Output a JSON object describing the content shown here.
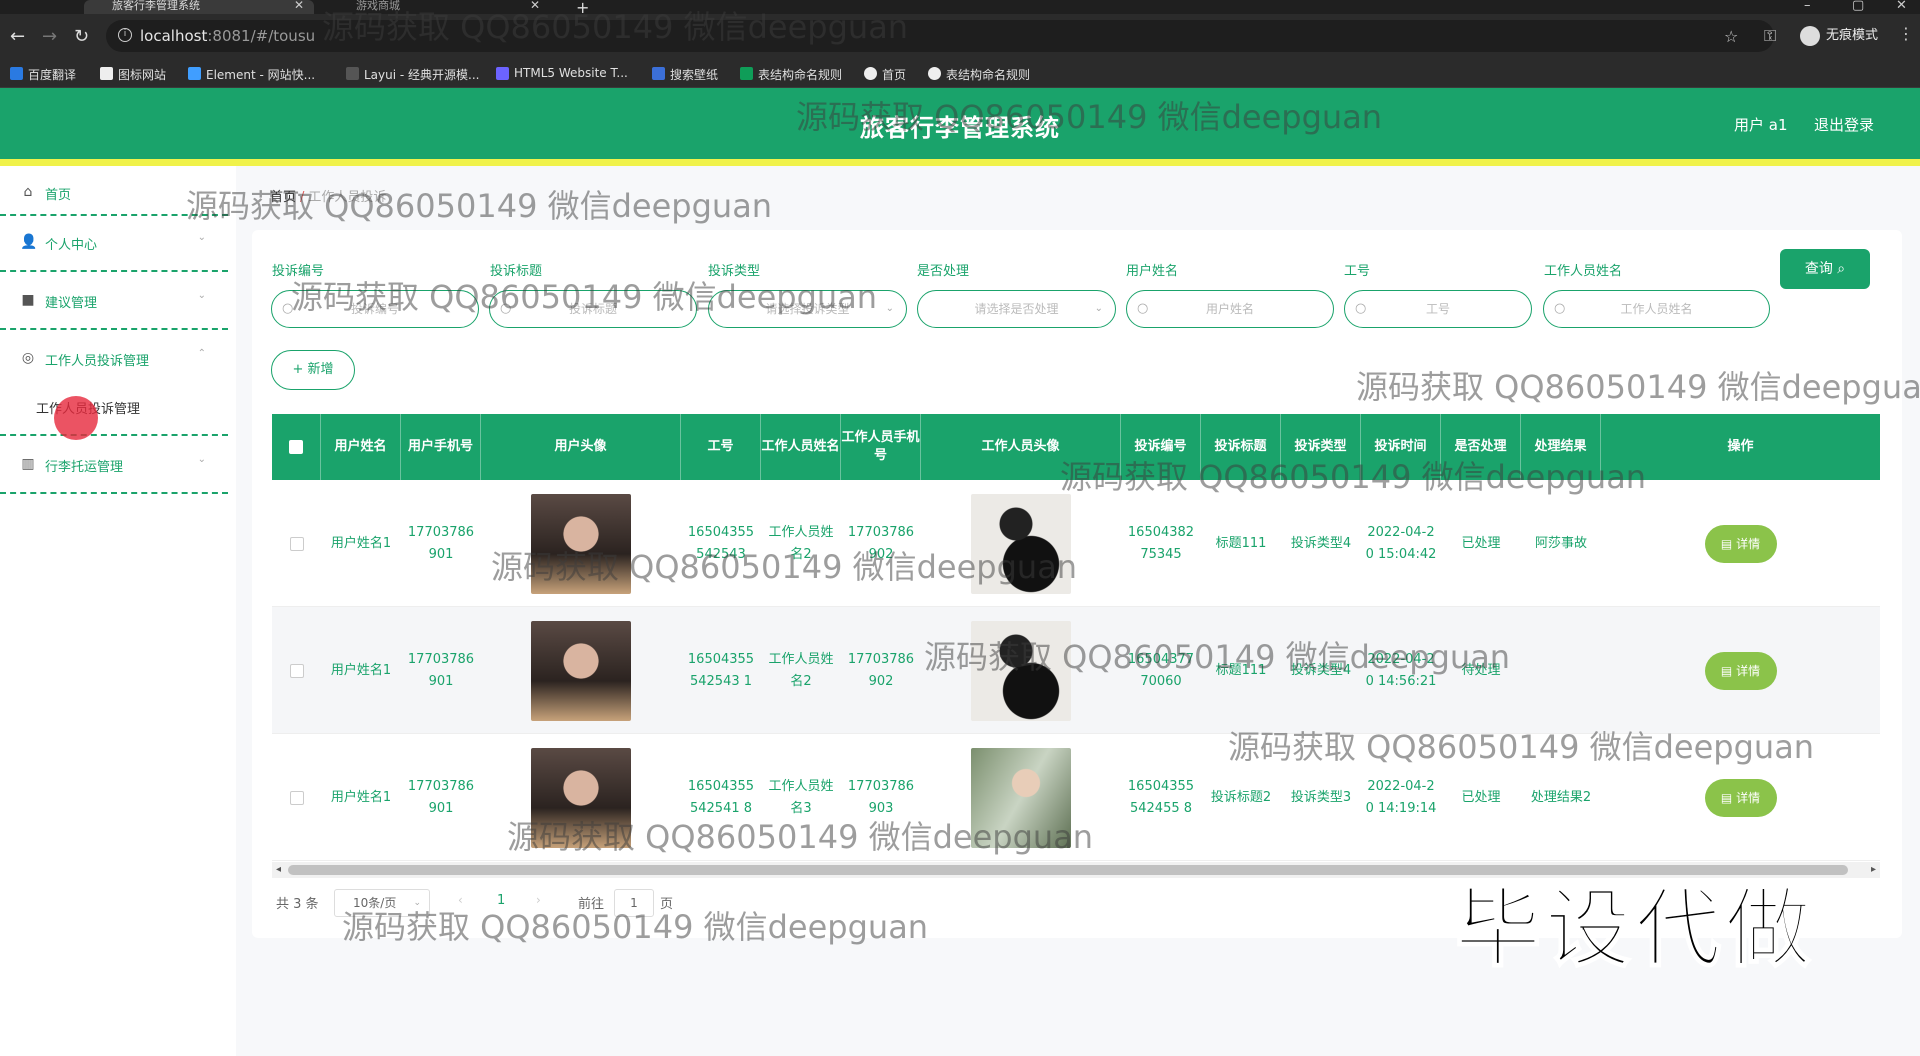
{
  "browser": {
    "active_tab": "旅客行李管理系统",
    "other_tab": "游戏商城",
    "url_host": "localhost",
    "url_path": ":8081/#/tousu",
    "incognito_label": "无痕模式",
    "bookmarks": [
      "百度翻译",
      "图标网站",
      "Element - 网站快...",
      "Layui - 经典开源模...",
      "HTML5 Website T...",
      "搜索壁纸",
      "表结构命名规则",
      "首页",
      "表结构命名规则"
    ]
  },
  "header": {
    "title": "旅客行李管理系统",
    "user": "用户 a1",
    "logout": "退出登录"
  },
  "sidebar": {
    "items": [
      {
        "label": "首页",
        "icon": "home-icon"
      },
      {
        "label": "个人中心",
        "icon": "user-icon"
      },
      {
        "label": "建议管理",
        "icon": "video-icon"
      },
      {
        "label": "工作人员投诉管理",
        "icon": "compass-icon"
      },
      {
        "label": "工作人员投诉管理",
        "icon": ""
      },
      {
        "label": "行李托运管理",
        "icon": "chart-icon"
      }
    ]
  },
  "breadcrumb": {
    "home": "首页",
    "sep": "/",
    "current": "工作人员投诉"
  },
  "filters": {
    "labels": [
      "投诉编号",
      "投诉标题",
      "投诉类型",
      "是否处理",
      "用户姓名",
      "工号",
      "工作人员姓名"
    ],
    "placeholders": [
      "投诉编号",
      "投诉标题",
      "请选择投诉类型",
      "请选择是否处理",
      "用户姓名",
      "工号",
      "工作人员姓名"
    ],
    "query_btn": "查询 ⌕",
    "add_btn": "+ 新增"
  },
  "table": {
    "headers": [
      "用户姓名",
      "用户手机号",
      "用户头像",
      "工号",
      "工作人员姓名",
      "工作人员手机号",
      "工作人员头像",
      "投诉编号",
      "投诉标题",
      "投诉类型",
      "投诉时间",
      "是否处理",
      "处理结果",
      "操作"
    ],
    "rows": [
      {
        "user_name": "用户姓名1",
        "user_phone": "17703786901",
        "job_no": "16504355542543",
        "staff_name": "工作人员姓名2",
        "staff_phone": "17703786902",
        "complaint_no": "1650438275345",
        "title": "标题111",
        "type": "投诉类型4",
        "time": "2022-04-20 15:04:42",
        "handled": "已处理",
        "result": "阿莎事故",
        "action": "详情"
      },
      {
        "user_name": "用户姓名1",
        "user_phone": "17703786901",
        "job_no": "16504355542543 1",
        "staff_name": "工作人员姓名2",
        "staff_phone": "17703786902",
        "complaint_no": "1650437770060",
        "title": "标题111",
        "type": "投诉类型4",
        "time": "2022-04-20 14:56:21",
        "handled": "待处理",
        "result": "",
        "action": "详情"
      },
      {
        "user_name": "用户姓名1",
        "user_phone": "17703786901",
        "job_no": "16504355542541 8",
        "staff_name": "工作人员姓名3",
        "staff_phone": "17703786903",
        "complaint_no": "16504355542455 8",
        "title": "投诉标题2",
        "type": "投诉类型3",
        "time": "2022-04-20 14:19:14",
        "handled": "已处理",
        "result": "处理结果2",
        "action": "详情"
      }
    ]
  },
  "pagination": {
    "total": "共 3 条",
    "page_size": "10条/页",
    "current": "1",
    "goto": "前往",
    "goto_value": "1",
    "page_unit": "页"
  },
  "watermarks": {
    "text": "源码获取 QQ86050149 微信deepguan",
    "big": "毕设代做"
  }
}
